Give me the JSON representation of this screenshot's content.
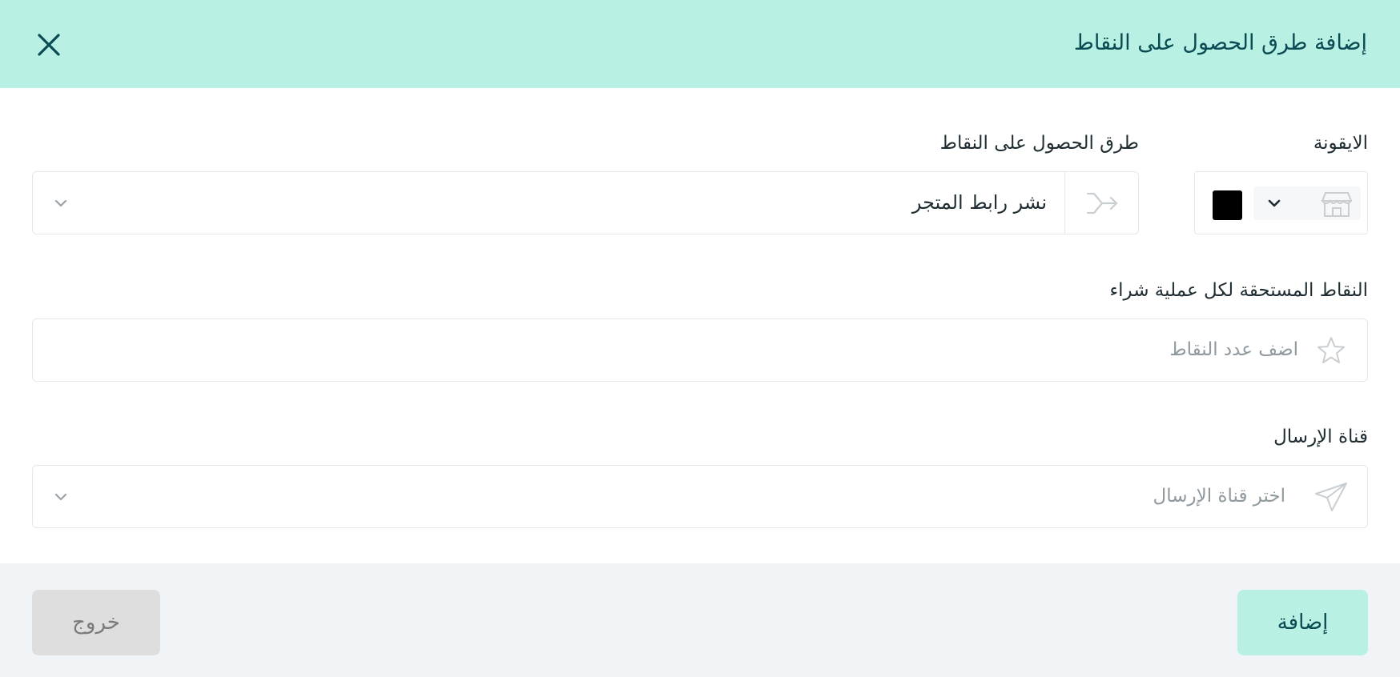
{
  "header": {
    "title": "إضافة طرق الحصول على النقاط"
  },
  "form": {
    "icon_label": "الايقونة",
    "swatch_color": "#000000",
    "method_label": "طرق الحصول على النقاط",
    "method_value": "نشر رابط المتجر",
    "points_label": "النقاط المستحقة لكل عملية شراء",
    "points_placeholder": "اضف عدد النقاط",
    "channel_label": "قناة الإرسال",
    "channel_placeholder": "اختر قناة الإرسال"
  },
  "footer": {
    "add_label": "إضافة",
    "exit_label": "خروج"
  }
}
